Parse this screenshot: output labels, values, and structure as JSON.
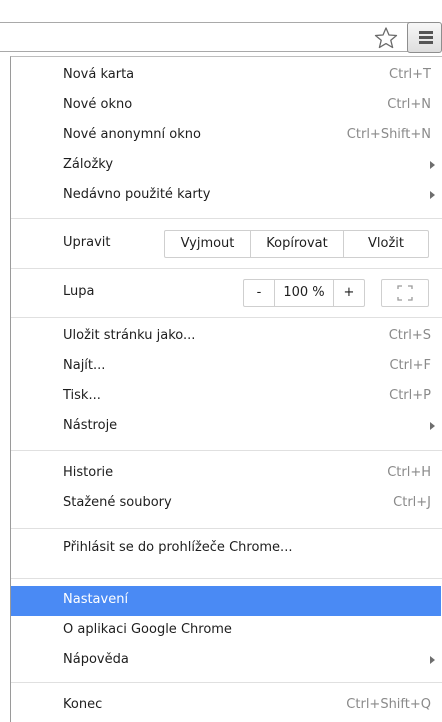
{
  "menu": {
    "group1": [
      {
        "label": "Nová karta",
        "shortcut": "Ctrl+T"
      },
      {
        "label": "Nové okno",
        "shortcut": "Ctrl+N"
      },
      {
        "label": "Nové anonymní okno",
        "shortcut": "Ctrl+Shift+N"
      },
      {
        "label": "Záložky",
        "submenu": true
      },
      {
        "label": "Nedávno použité karty",
        "submenu": true
      }
    ],
    "edit": {
      "label": "Upravit",
      "cut": "Vyjmout",
      "copy": "Kopírovat",
      "paste": "Vložit"
    },
    "zoom": {
      "label": "Lupa",
      "minus": "-",
      "value": "100 %",
      "plus": "+"
    },
    "group3": [
      {
        "label": "Uložit stránku jako...",
        "shortcut": "Ctrl+S"
      },
      {
        "label": "Najít...",
        "shortcut": "Ctrl+F"
      },
      {
        "label": "Tisk...",
        "shortcut": "Ctrl+P"
      },
      {
        "label": "Nástroje",
        "submenu": true
      }
    ],
    "group4": [
      {
        "label": "Historie",
        "shortcut": "Ctrl+H"
      },
      {
        "label": "Stažené soubory",
        "shortcut": "Ctrl+J"
      }
    ],
    "signin": {
      "label": "Přihlásit se do prohlížeče Chrome..."
    },
    "group5": [
      {
        "label": "Nastavení",
        "selected": true
      },
      {
        "label": "O aplikaci Google Chrome"
      },
      {
        "label": "Nápověda",
        "submenu": true
      }
    ],
    "exit": {
      "label": "Konec",
      "shortcut": "Ctrl+Shift+Q"
    }
  },
  "colors": {
    "selected_bg": "#4a8af4",
    "shortcut_text": "#8a8a8a"
  }
}
